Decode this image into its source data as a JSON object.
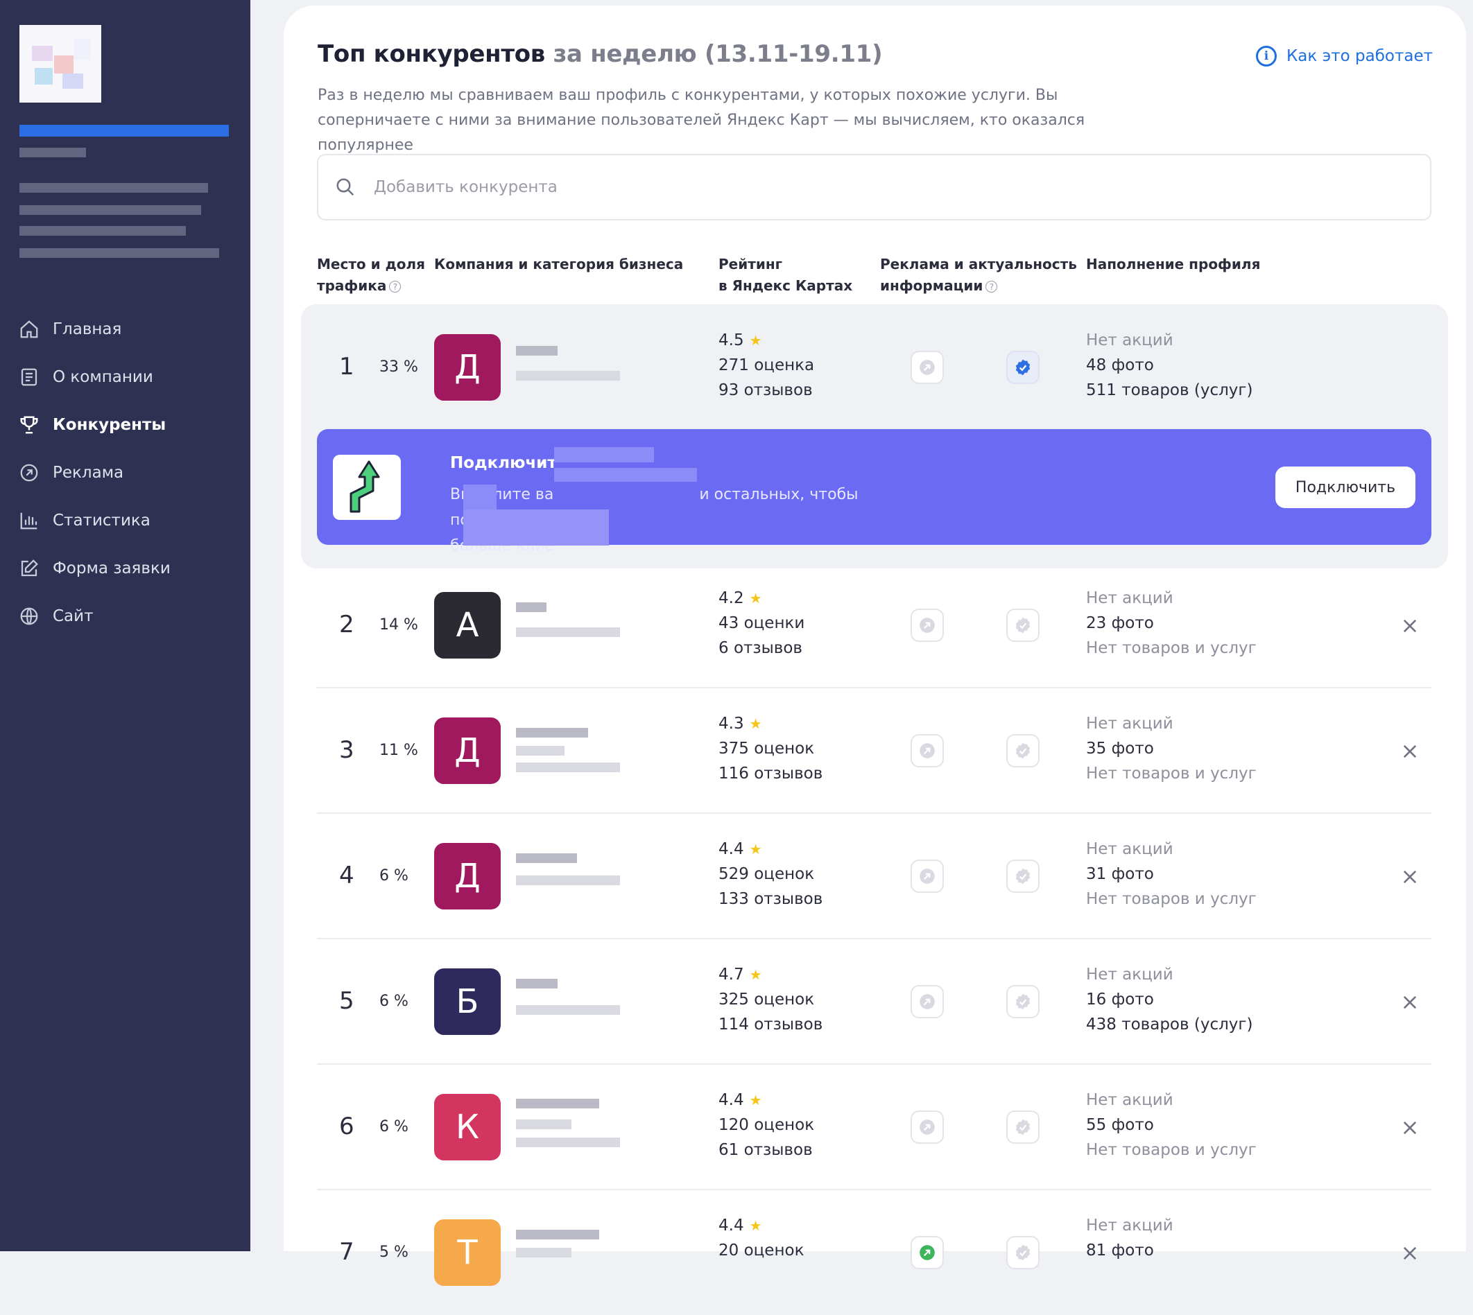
{
  "nav": {
    "items": [
      {
        "label": "Главная",
        "icon": "home-icon"
      },
      {
        "label": "О компании",
        "icon": "document-icon"
      },
      {
        "label": "Конкуренты",
        "icon": "trophy-icon",
        "active": true
      },
      {
        "label": "Реклама",
        "icon": "arrow-circle-icon"
      },
      {
        "label": "Статистика",
        "icon": "bar-chart-icon"
      },
      {
        "label": "Форма заявки",
        "icon": "edit-icon"
      },
      {
        "label": "Сайт",
        "icon": "globe-icon"
      }
    ]
  },
  "header": {
    "title": "Топ конкурентов",
    "title_period": "за неделю (13.11-19.11)",
    "help_link": "Как это работает",
    "description": "Раз в неделю мы сравниваем ваш профиль с конкурентами, у которых похожие услуги. Вы соперничаете с ними за внимание пользователей Яндекс Карт — мы вычисляем, кто оказался популярнее"
  },
  "search": {
    "placeholder": "Добавить конкурента"
  },
  "table": {
    "headers": {
      "place_line1": "Место и доля",
      "place_line2": "трафика",
      "company": "Компания и категория бизнеса",
      "rating_line1": "Рейтинг",
      "rating_line2": "в Яндекс Картах",
      "ads_line1": "Реклама и актуальность",
      "ads_line2": "информации",
      "profile": "Наполнение профиля"
    },
    "rows": [
      {
        "rank": "1",
        "share": "33 %",
        "letter": "Д",
        "color": "#a0195f",
        "rating": "4.5",
        "ratings_count": "271 оценка",
        "reviews": "93 отзывов",
        "promo": "Нет акций",
        "photos": "48 фото",
        "goods": "511 товаров (услуг)",
        "verified": true
      },
      {
        "rank": "2",
        "share": "14 %",
        "letter": "А",
        "color": "#2b2a33",
        "rating": "4.2",
        "ratings_count": "43 оценки",
        "reviews": "6 отзывов",
        "promo": "Нет акций",
        "photos": "23 фото",
        "goods": "Нет товаров и услуг",
        "verified": false
      },
      {
        "rank": "3",
        "share": "11 %",
        "letter": "Д",
        "color": "#a0195f",
        "rating": "4.3",
        "ratings_count": "375 оценок",
        "reviews": "116 отзывов",
        "promo": "Нет акций",
        "photos": "35 фото",
        "goods": "Нет товаров и услуг",
        "verified": false
      },
      {
        "rank": "4",
        "share": "6 %",
        "letter": "Д",
        "color": "#a0195f",
        "rating": "4.4",
        "ratings_count": "529 оценок",
        "reviews": "133 отзывов",
        "promo": "Нет акций",
        "photos": "31 фото",
        "goods": "Нет товаров и услуг",
        "verified": false
      },
      {
        "rank": "5",
        "share": "6 %",
        "letter": "Б",
        "color": "#2f2a5e",
        "rating": "4.7",
        "ratings_count": "325 оценок",
        "reviews": "114 отзывов",
        "promo": "Нет акций",
        "photos": "16 фото",
        "goods": "438 товаров (услуг)",
        "verified": false
      },
      {
        "rank": "6",
        "share": "6 %",
        "letter": "К",
        "color": "#d2355f",
        "rating": "4.4",
        "ratings_count": "120 оценок",
        "reviews": "61 отзывов",
        "promo": "Нет акций",
        "photos": "55 фото",
        "goods": "Нет товаров и услуг",
        "verified": false
      },
      {
        "rank": "7",
        "share": "5 %",
        "letter": "Т",
        "color": "#f5a94a",
        "rating": "4.4",
        "ratings_count": "20 оценок",
        "reviews": "",
        "promo": "Нет акций",
        "photos": "81 фото",
        "goods": "",
        "verified": false
      }
    ]
  },
  "banner": {
    "title": "Подключит",
    "text_a": "Выделите ва",
    "text_b": "и остальных, чтобы получить",
    "text_c": "больше клие",
    "button": "Подключить"
  },
  "colors": {
    "sidebar": "#2e3152",
    "accent": "#1d6fe0",
    "banner": "#6a6af2",
    "star": "#f5c518"
  }
}
